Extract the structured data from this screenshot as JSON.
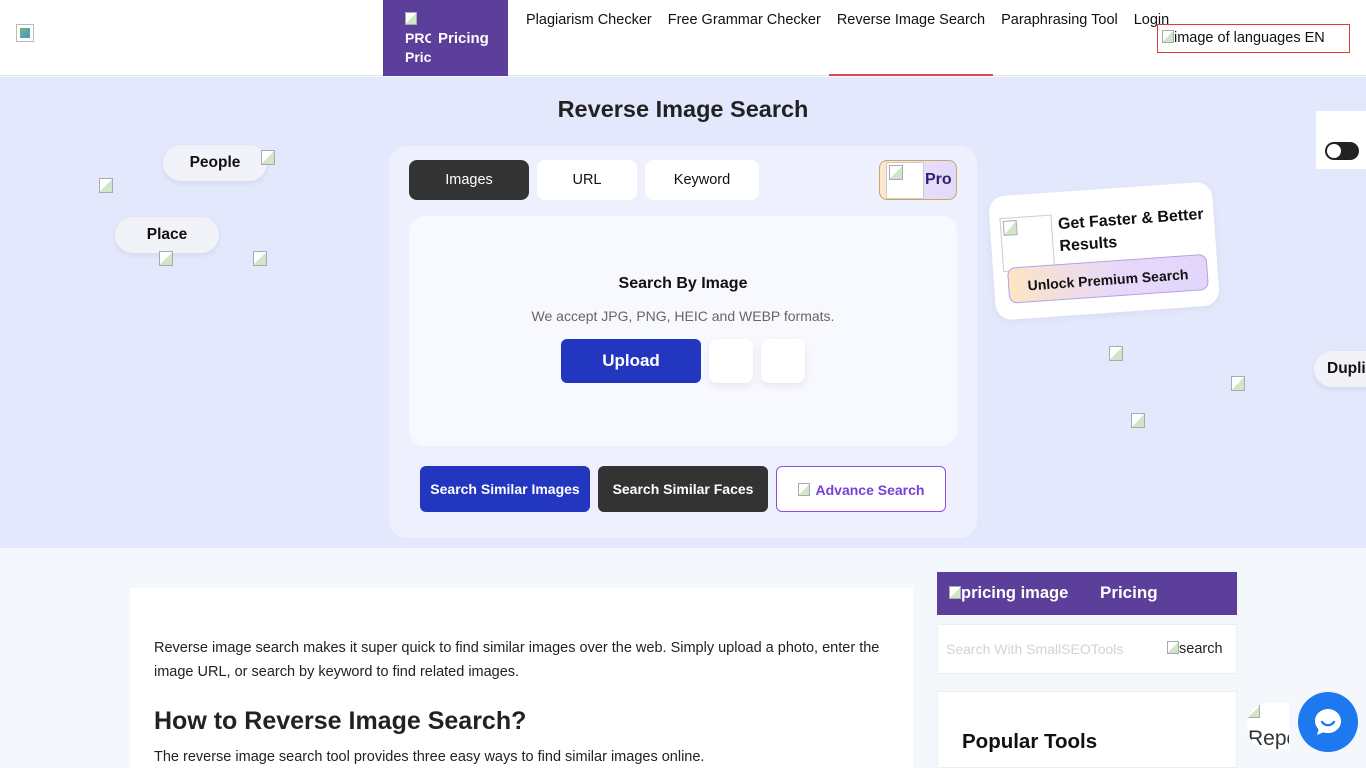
{
  "header": {
    "pricing_alt": "PRO Pric",
    "pricing_label": "Pricing",
    "nav": [
      "Plagiarism Checker",
      "Free Grammar Checker",
      "Reverse Image Search",
      "Paraphrasing Tool",
      "Login"
    ],
    "active_nav": "Reverse Image Search",
    "language_alt": "image of languages",
    "language_code": "EN"
  },
  "hero": {
    "title": "Reverse Image Search",
    "chips": [
      "People",
      "Place",
      "Duplic"
    ]
  },
  "search_card": {
    "tabs": [
      "Images",
      "URL",
      "Keyword"
    ],
    "active_tab": "Images",
    "pro_label": "Pro",
    "drop_title": "Search By Image",
    "drop_subtitle": "We accept JPG, PNG, HEIC and WEBP formats.",
    "upload_label": "Upload",
    "actions": {
      "similar_images": "Search Similar Images",
      "similar_faces": "Search Similar Faces",
      "advance": "Advance Search"
    }
  },
  "promo": {
    "heading": "Get Faster & Better Results",
    "button": "Unlock Premium Search"
  },
  "article": {
    "intro": "Reverse image search makes it super quick to find similar images over the web. Simply upload a photo, enter the image URL, or search by keyword to find related images.",
    "heading": "How to Reverse Image Search?",
    "body": "The reverse image search tool provides three easy ways to find similar images online."
  },
  "sidebar": {
    "pricing_alt": "pricing image",
    "pricing_label": "Pricing",
    "search_placeholder": "Search With SmallSEOTools",
    "search_alt": "search",
    "popular_title": "Popular Tools"
  },
  "widgets": {
    "report_label": "Report"
  },
  "colors": {
    "brand_purple": "#5b3f9a",
    "primary_blue": "#2336c0",
    "hero_bg": "#e4e8fc",
    "chat_blue": "#1e78f0",
    "active_underline": "#e0484f"
  }
}
